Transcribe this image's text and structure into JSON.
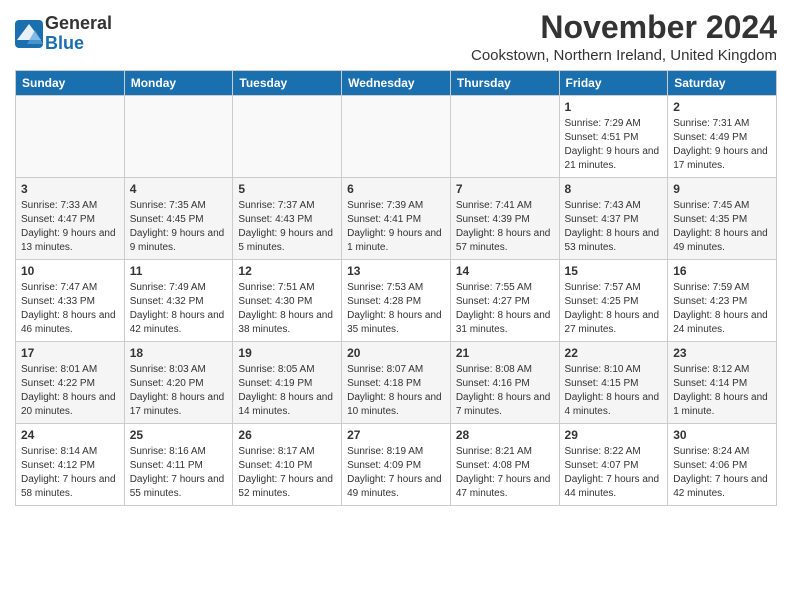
{
  "logo": {
    "general": "General",
    "blue": "Blue"
  },
  "title": "November 2024",
  "subtitle": "Cookstown, Northern Ireland, United Kingdom",
  "headers": [
    "Sunday",
    "Monday",
    "Tuesday",
    "Wednesday",
    "Thursday",
    "Friday",
    "Saturday"
  ],
  "weeks": [
    [
      {
        "day": "",
        "info": ""
      },
      {
        "day": "",
        "info": ""
      },
      {
        "day": "",
        "info": ""
      },
      {
        "day": "",
        "info": ""
      },
      {
        "day": "",
        "info": ""
      },
      {
        "day": "1",
        "info": "Sunrise: 7:29 AM\nSunset: 4:51 PM\nDaylight: 9 hours\nand 21 minutes."
      },
      {
        "day": "2",
        "info": "Sunrise: 7:31 AM\nSunset: 4:49 PM\nDaylight: 9 hours\nand 17 minutes."
      }
    ],
    [
      {
        "day": "3",
        "info": "Sunrise: 7:33 AM\nSunset: 4:47 PM\nDaylight: 9 hours\nand 13 minutes."
      },
      {
        "day": "4",
        "info": "Sunrise: 7:35 AM\nSunset: 4:45 PM\nDaylight: 9 hours\nand 9 minutes."
      },
      {
        "day": "5",
        "info": "Sunrise: 7:37 AM\nSunset: 4:43 PM\nDaylight: 9 hours\nand 5 minutes."
      },
      {
        "day": "6",
        "info": "Sunrise: 7:39 AM\nSunset: 4:41 PM\nDaylight: 9 hours\nand 1 minute."
      },
      {
        "day": "7",
        "info": "Sunrise: 7:41 AM\nSunset: 4:39 PM\nDaylight: 8 hours\nand 57 minutes."
      },
      {
        "day": "8",
        "info": "Sunrise: 7:43 AM\nSunset: 4:37 PM\nDaylight: 8 hours\nand 53 minutes."
      },
      {
        "day": "9",
        "info": "Sunrise: 7:45 AM\nSunset: 4:35 PM\nDaylight: 8 hours\nand 49 minutes."
      }
    ],
    [
      {
        "day": "10",
        "info": "Sunrise: 7:47 AM\nSunset: 4:33 PM\nDaylight: 8 hours\nand 46 minutes."
      },
      {
        "day": "11",
        "info": "Sunrise: 7:49 AM\nSunset: 4:32 PM\nDaylight: 8 hours\nand 42 minutes."
      },
      {
        "day": "12",
        "info": "Sunrise: 7:51 AM\nSunset: 4:30 PM\nDaylight: 8 hours\nand 38 minutes."
      },
      {
        "day": "13",
        "info": "Sunrise: 7:53 AM\nSunset: 4:28 PM\nDaylight: 8 hours\nand 35 minutes."
      },
      {
        "day": "14",
        "info": "Sunrise: 7:55 AM\nSunset: 4:27 PM\nDaylight: 8 hours\nand 31 minutes."
      },
      {
        "day": "15",
        "info": "Sunrise: 7:57 AM\nSunset: 4:25 PM\nDaylight: 8 hours\nand 27 minutes."
      },
      {
        "day": "16",
        "info": "Sunrise: 7:59 AM\nSunset: 4:23 PM\nDaylight: 8 hours\nand 24 minutes."
      }
    ],
    [
      {
        "day": "17",
        "info": "Sunrise: 8:01 AM\nSunset: 4:22 PM\nDaylight: 8 hours\nand 20 minutes."
      },
      {
        "day": "18",
        "info": "Sunrise: 8:03 AM\nSunset: 4:20 PM\nDaylight: 8 hours\nand 17 minutes."
      },
      {
        "day": "19",
        "info": "Sunrise: 8:05 AM\nSunset: 4:19 PM\nDaylight: 8 hours\nand 14 minutes."
      },
      {
        "day": "20",
        "info": "Sunrise: 8:07 AM\nSunset: 4:18 PM\nDaylight: 8 hours\nand 10 minutes."
      },
      {
        "day": "21",
        "info": "Sunrise: 8:08 AM\nSunset: 4:16 PM\nDaylight: 8 hours\nand 7 minutes."
      },
      {
        "day": "22",
        "info": "Sunrise: 8:10 AM\nSunset: 4:15 PM\nDaylight: 8 hours\nand 4 minutes."
      },
      {
        "day": "23",
        "info": "Sunrise: 8:12 AM\nSunset: 4:14 PM\nDaylight: 8 hours\nand 1 minute."
      }
    ],
    [
      {
        "day": "24",
        "info": "Sunrise: 8:14 AM\nSunset: 4:12 PM\nDaylight: 7 hours\nand 58 minutes."
      },
      {
        "day": "25",
        "info": "Sunrise: 8:16 AM\nSunset: 4:11 PM\nDaylight: 7 hours\nand 55 minutes."
      },
      {
        "day": "26",
        "info": "Sunrise: 8:17 AM\nSunset: 4:10 PM\nDaylight: 7 hours\nand 52 minutes."
      },
      {
        "day": "27",
        "info": "Sunrise: 8:19 AM\nSunset: 4:09 PM\nDaylight: 7 hours\nand 49 minutes."
      },
      {
        "day": "28",
        "info": "Sunrise: 8:21 AM\nSunset: 4:08 PM\nDaylight: 7 hours\nand 47 minutes."
      },
      {
        "day": "29",
        "info": "Sunrise: 8:22 AM\nSunset: 4:07 PM\nDaylight: 7 hours\nand 44 minutes."
      },
      {
        "day": "30",
        "info": "Sunrise: 8:24 AM\nSunset: 4:06 PM\nDaylight: 7 hours\nand 42 minutes."
      }
    ]
  ]
}
